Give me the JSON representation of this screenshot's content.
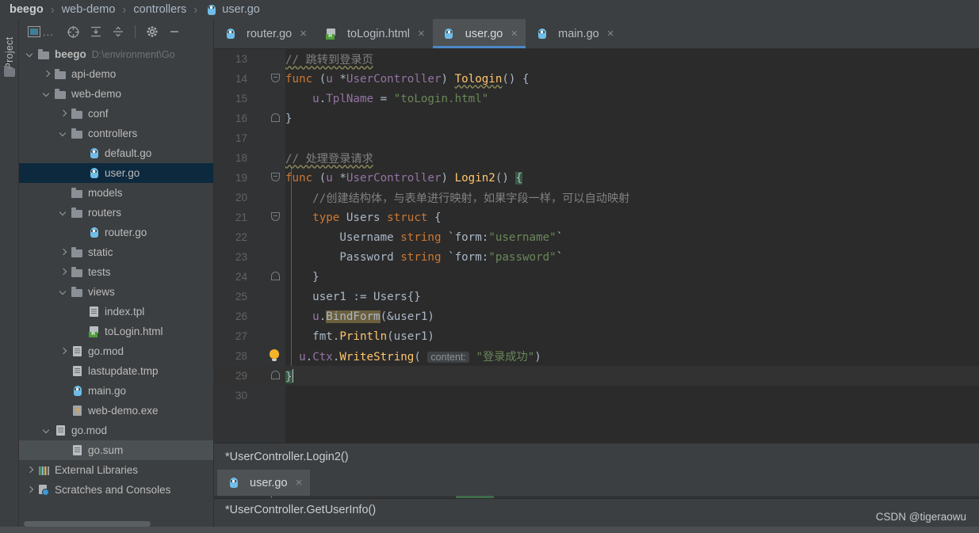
{
  "breadcrumb": {
    "items": [
      {
        "label": "beego",
        "icon": "none"
      },
      {
        "label": "web-demo",
        "icon": "none"
      },
      {
        "label": "controllers",
        "icon": "none"
      },
      {
        "label": "user.go",
        "icon": "go-file-icon"
      }
    ],
    "separator": "›"
  },
  "toolwindow": {
    "vertical_label": "Project",
    "folder_icon": "folder-icon",
    "toolbar": {
      "window_icon": "project-window-icon",
      "ellipsis": "...",
      "locate_icon": "scroll-from-source-icon",
      "expand_icon": "expand-all-icon",
      "collapse_icon": "collapse-all-icon",
      "settings_icon": "gear-icon",
      "hide_icon": "hide-panel-icon"
    }
  },
  "tree": [
    {
      "indent": 0,
      "arrow": "down",
      "icon": "folder",
      "label": "beego",
      "sub": "D:\\environment\\Go",
      "state": "normal"
    },
    {
      "indent": 1,
      "arrow": "right",
      "icon": "folder",
      "label": "api-demo",
      "sub": "",
      "state": "normal"
    },
    {
      "indent": 1,
      "arrow": "down",
      "icon": "folder",
      "label": "web-demo",
      "sub": "",
      "state": "normal"
    },
    {
      "indent": 2,
      "arrow": "right",
      "icon": "folder",
      "label": "conf",
      "sub": "",
      "state": "normal"
    },
    {
      "indent": 2,
      "arrow": "down",
      "icon": "folder",
      "label": "controllers",
      "sub": "",
      "state": "normal"
    },
    {
      "indent": 3,
      "arrow": "none",
      "icon": "go",
      "label": "default.go",
      "sub": "",
      "state": "normal"
    },
    {
      "indent": 3,
      "arrow": "none",
      "icon": "go",
      "label": "user.go",
      "sub": "",
      "state": "selected"
    },
    {
      "indent": 2,
      "arrow": "none",
      "icon": "folder",
      "label": "models",
      "sub": "",
      "state": "normal"
    },
    {
      "indent": 2,
      "arrow": "down",
      "icon": "folder",
      "label": "routers",
      "sub": "",
      "state": "normal"
    },
    {
      "indent": 3,
      "arrow": "none",
      "icon": "go",
      "label": "router.go",
      "sub": "",
      "state": "normal"
    },
    {
      "indent": 2,
      "arrow": "right",
      "icon": "folder",
      "label": "static",
      "sub": "",
      "state": "normal"
    },
    {
      "indent": 2,
      "arrow": "right",
      "icon": "folder",
      "label": "tests",
      "sub": "",
      "state": "normal"
    },
    {
      "indent": 2,
      "arrow": "down",
      "icon": "folder",
      "label": "views",
      "sub": "",
      "state": "normal"
    },
    {
      "indent": 3,
      "arrow": "none",
      "icon": "file",
      "label": "index.tpl",
      "sub": "",
      "state": "normal"
    },
    {
      "indent": 3,
      "arrow": "none",
      "icon": "html",
      "label": "toLogin.html",
      "sub": "",
      "state": "normal"
    },
    {
      "indent": 2,
      "arrow": "right",
      "icon": "file",
      "label": "go.mod",
      "sub": "",
      "state": "normal"
    },
    {
      "indent": 2,
      "arrow": "none",
      "icon": "file",
      "label": "lastupdate.tmp",
      "sub": "",
      "state": "normal"
    },
    {
      "indent": 2,
      "arrow": "none",
      "icon": "go",
      "label": "main.go",
      "sub": "",
      "state": "normal"
    },
    {
      "indent": 2,
      "arrow": "none",
      "icon": "exe",
      "label": "web-demo.exe",
      "sub": "",
      "state": "normal"
    },
    {
      "indent": 1,
      "arrow": "down",
      "icon": "file",
      "label": "go.mod",
      "sub": "",
      "state": "normal"
    },
    {
      "indent": 2,
      "arrow": "none",
      "icon": "file",
      "label": "go.sum",
      "sub": "",
      "state": "hover"
    },
    {
      "indent": 0,
      "arrow": "right",
      "icon": "libs",
      "label": "External Libraries",
      "sub": "",
      "state": "normal"
    },
    {
      "indent": 0,
      "arrow": "right",
      "icon": "scratch",
      "label": "Scratches and Consoles",
      "sub": "",
      "state": "normal"
    }
  ],
  "editor_tabs": [
    {
      "label": "router.go",
      "icon": "go-file-icon",
      "active": false,
      "close": "×"
    },
    {
      "label": "toLogin.html",
      "icon": "html-file-icon",
      "active": false,
      "close": "×"
    },
    {
      "label": "user.go",
      "icon": "go-file-icon",
      "active": true,
      "close": "×"
    },
    {
      "label": "main.go",
      "icon": "go-file-icon",
      "active": false,
      "close": "×"
    }
  ],
  "code": {
    "language": "Go",
    "lines": [
      {
        "no": "13",
        "fold": "none",
        "bulb": false,
        "current": false
      },
      {
        "no": "14",
        "fold": "open",
        "bulb": false,
        "current": false
      },
      {
        "no": "15",
        "fold": "none",
        "bulb": false,
        "current": false
      },
      {
        "no": "16",
        "fold": "close",
        "bulb": false,
        "current": false
      },
      {
        "no": "17",
        "fold": "none",
        "bulb": false,
        "current": false
      },
      {
        "no": "18",
        "fold": "none",
        "bulb": false,
        "current": false
      },
      {
        "no": "19",
        "fold": "open",
        "bulb": false,
        "current": false
      },
      {
        "no": "20",
        "fold": "none",
        "bulb": false,
        "current": false
      },
      {
        "no": "21",
        "fold": "open",
        "bulb": false,
        "current": false
      },
      {
        "no": "22",
        "fold": "none",
        "bulb": false,
        "current": false
      },
      {
        "no": "23",
        "fold": "none",
        "bulb": false,
        "current": false
      },
      {
        "no": "24",
        "fold": "close",
        "bulb": false,
        "current": false
      },
      {
        "no": "25",
        "fold": "none",
        "bulb": false,
        "current": false
      },
      {
        "no": "26",
        "fold": "none",
        "bulb": false,
        "current": false
      },
      {
        "no": "27",
        "fold": "none",
        "bulb": false,
        "current": false
      },
      {
        "no": "28",
        "fold": "none",
        "bulb": true,
        "current": false
      },
      {
        "no": "29",
        "fold": "close",
        "bulb": false,
        "current": true
      },
      {
        "no": "30",
        "fold": "none",
        "bulb": false,
        "current": false
      }
    ],
    "text": {
      "l13": "// 跳转到登录页",
      "l14": "func (u *UserController) Tologin() {",
      "l15": "u.TplName = \"toLogin.html\"",
      "l16": "}",
      "l18": "// 处理登录请求",
      "l19": "func (u *UserController) Login2() {",
      "l20": "//创建结构体，与表单进行映射，如果字段一样，可以自动映射",
      "l21": "type Users struct {",
      "l22": "Username string `form:\"username\"`",
      "l23": "Password string `form:\"password\"`",
      "l24": "}",
      "l25": "user1 := Users{}",
      "l26": "u.BindForm(&user1)",
      "l27": "fmt.Println(user1)",
      "l28": "u.Ctx.WriteString( content: \"登录成功\")",
      "l29": "}",
      "inlay_hint": "content:"
    }
  },
  "bottom": {
    "status_top": "*UserController.Login2()",
    "status_bottom": "*UserController.GetUserInfo()",
    "tab": {
      "label": "user.go",
      "icon": "go-file-icon",
      "close": "×"
    },
    "watermark": "CSDN @tigeraowu"
  }
}
